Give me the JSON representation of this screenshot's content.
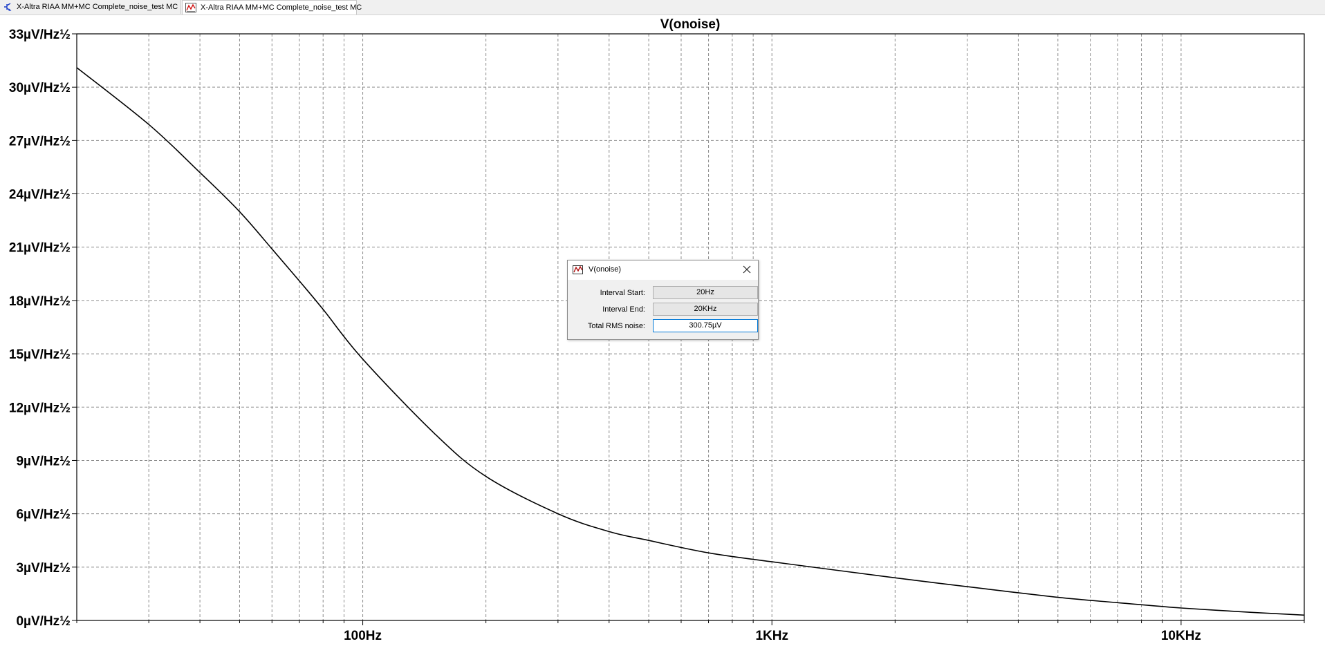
{
  "tabs": [
    {
      "label": "X-Altra RIAA MM+MC Complete_noise_test MC",
      "icon": "schematic-icon"
    },
    {
      "label": "X-Altra RIAA MM+MC Complete_noise_test MC",
      "icon": "waveform-icon"
    }
  ],
  "chart_data": {
    "type": "line",
    "title": "V(onoise)",
    "xscale": "log",
    "xlim": [
      20,
      20000
    ],
    "ylim": [
      0,
      33
    ],
    "grid": true,
    "x_ticks": [
      "100Hz",
      "1KHz",
      "10KHz"
    ],
    "y_ticks": [
      "0µV/Hz½",
      "3µV/Hz½",
      "6µV/Hz½",
      "9µV/Hz½",
      "12µV/Hz½",
      "15µV/Hz½",
      "18µV/Hz½",
      "21µV/Hz½",
      "24µV/Hz½",
      "27µV/Hz½",
      "30µV/Hz½",
      "33µV/Hz½"
    ],
    "series": [
      {
        "name": "V(onoise)",
        "color": "#000000",
        "x": [
          20,
          30,
          40,
          50,
          60,
          70,
          80,
          100,
          150,
          200,
          300,
          400,
          500,
          700,
          1000,
          2000,
          3000,
          5000,
          7000,
          10000,
          15000,
          20000
        ],
        "y": [
          31.1,
          27.9,
          25.2,
          23.0,
          20.9,
          19.1,
          17.5,
          14.7,
          10.5,
          8.1,
          6.0,
          5.0,
          4.5,
          3.8,
          3.3,
          2.4,
          1.9,
          1.3,
          1.0,
          0.7,
          0.45,
          0.3
        ]
      }
    ]
  },
  "dialog": {
    "title": "V(onoise)",
    "rows": [
      {
        "label": "Interval Start:",
        "value": "20Hz"
      },
      {
        "label": "Interval End:",
        "value": "20KHz"
      },
      {
        "label": "Total RMS noise:",
        "value": "300.75µV"
      }
    ]
  }
}
